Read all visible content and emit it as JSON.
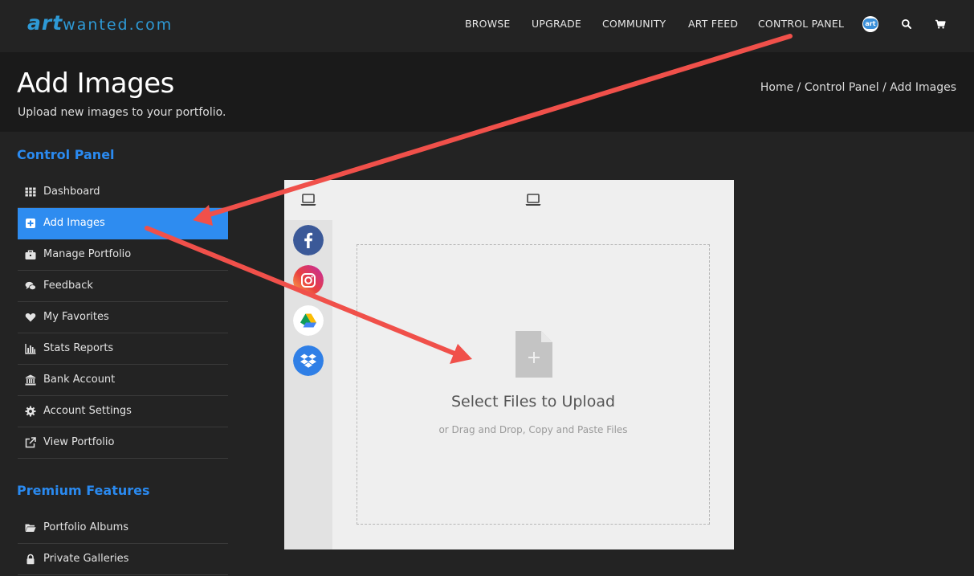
{
  "brand": {
    "logo_art": "art",
    "logo_rest": "wanted.com"
  },
  "nav": {
    "items": [
      {
        "label": "BROWSE"
      },
      {
        "label": "UPGRADE"
      },
      {
        "label": "COMMUNITY"
      },
      {
        "label": "ART FEED"
      },
      {
        "label": "CONTROL PANEL"
      }
    ],
    "avatar_badge": "art",
    "icons": [
      "search-icon",
      "cart-icon"
    ]
  },
  "header": {
    "title": "Add Images",
    "subtitle": "Upload new images to your portfolio.",
    "breadcrumb": [
      "Home",
      "Control Panel",
      "Add Images"
    ],
    "breadcrumb_separator": "/"
  },
  "sidebar": {
    "control_panel_heading": "Control Panel",
    "items": [
      {
        "label": "Dashboard",
        "icon": "grid-icon",
        "active": false
      },
      {
        "label": "Add Images",
        "icon": "plus-square-icon",
        "active": true
      },
      {
        "label": "Manage Portfolio",
        "icon": "briefcase-icon",
        "active": false
      },
      {
        "label": "Feedback",
        "icon": "comments-icon",
        "active": false
      },
      {
        "label": "My Favorites",
        "icon": "heart-icon",
        "active": false
      },
      {
        "label": "Stats Reports",
        "icon": "bar-chart-icon",
        "active": false
      },
      {
        "label": "Bank Account",
        "icon": "bank-icon",
        "active": false
      },
      {
        "label": "Account Settings",
        "icon": "gear-icon",
        "active": false
      },
      {
        "label": "View Portfolio",
        "icon": "external-link-icon",
        "active": false
      }
    ],
    "premium_heading": "Premium Features",
    "premium_items": [
      {
        "label": "Portfolio Albums",
        "icon": "folder-open-icon"
      },
      {
        "label": "Private Galleries",
        "icon": "lock-icon"
      }
    ]
  },
  "uploader": {
    "sources": [
      "facebook-icon",
      "instagram-icon",
      "google-drive-icon",
      "dropbox-icon"
    ],
    "drop_title": "Select Files to Upload",
    "drop_subtitle": "or Drag and Drop, Copy and Paste Files"
  },
  "colors": {
    "accent": "#2e8cf0",
    "heading_blue": "#2a8af0",
    "annotation_arrow": "#f0504a",
    "page_bg": "#232323",
    "header_band": "#1a1a1a"
  }
}
